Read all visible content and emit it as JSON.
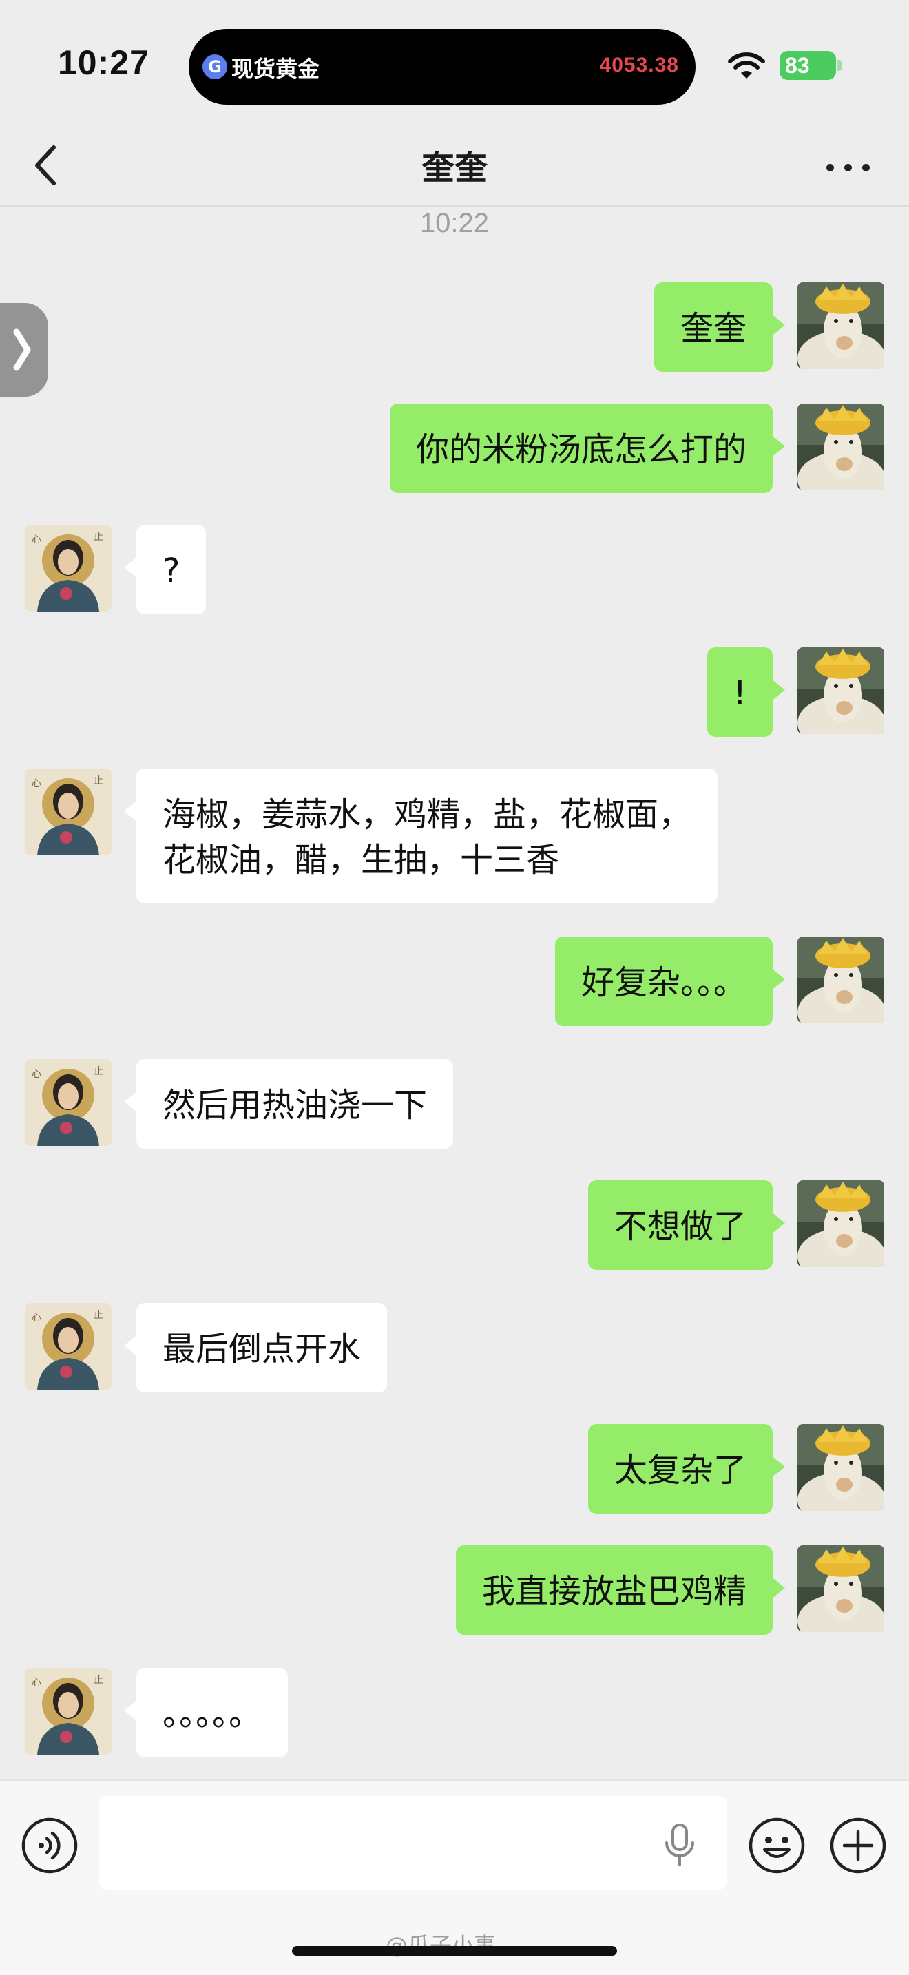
{
  "status_bar": {
    "time": "10:27",
    "island_label": "现货黄金",
    "island_value": "4053.38",
    "battery": "83"
  },
  "nav": {
    "title": "奎奎"
  },
  "chat": {
    "timestamp": "10:22",
    "messages": [
      {
        "side": "right",
        "text": "奎奎"
      },
      {
        "side": "right",
        "text": "你的米粉汤底怎么打的"
      },
      {
        "side": "left",
        "text": "?"
      },
      {
        "side": "right",
        "text": "!"
      },
      {
        "side": "left",
        "text": "海椒，姜蒜水，鸡精，盐，花椒面，\n花椒油，醋，生抽，十三香"
      },
      {
        "side": "right",
        "text": "好复杂。。。"
      },
      {
        "side": "left",
        "text": "然后用热油浇一下"
      },
      {
        "side": "right",
        "text": "不想做了"
      },
      {
        "side": "left",
        "text": "最后倒点开水"
      },
      {
        "side": "right",
        "text": "太复杂了"
      },
      {
        "side": "right",
        "text": "我直接放盐巴鸡精"
      },
      {
        "side": "left",
        "text": "。。。。。"
      }
    ]
  },
  "input_bar": {
    "placeholder": ""
  },
  "watermark": "@瓜子小事",
  "colors": {
    "background": "#ededed",
    "sent_bubble": "#95ec69",
    "received_bubble": "#ffffff",
    "island_value": "#e5484d",
    "battery": "#4ccb5e"
  },
  "icons": [
    "back-icon",
    "more-icon",
    "wifi-icon",
    "voice-icon",
    "microphone-icon",
    "emoji-icon",
    "plus-icon"
  ]
}
